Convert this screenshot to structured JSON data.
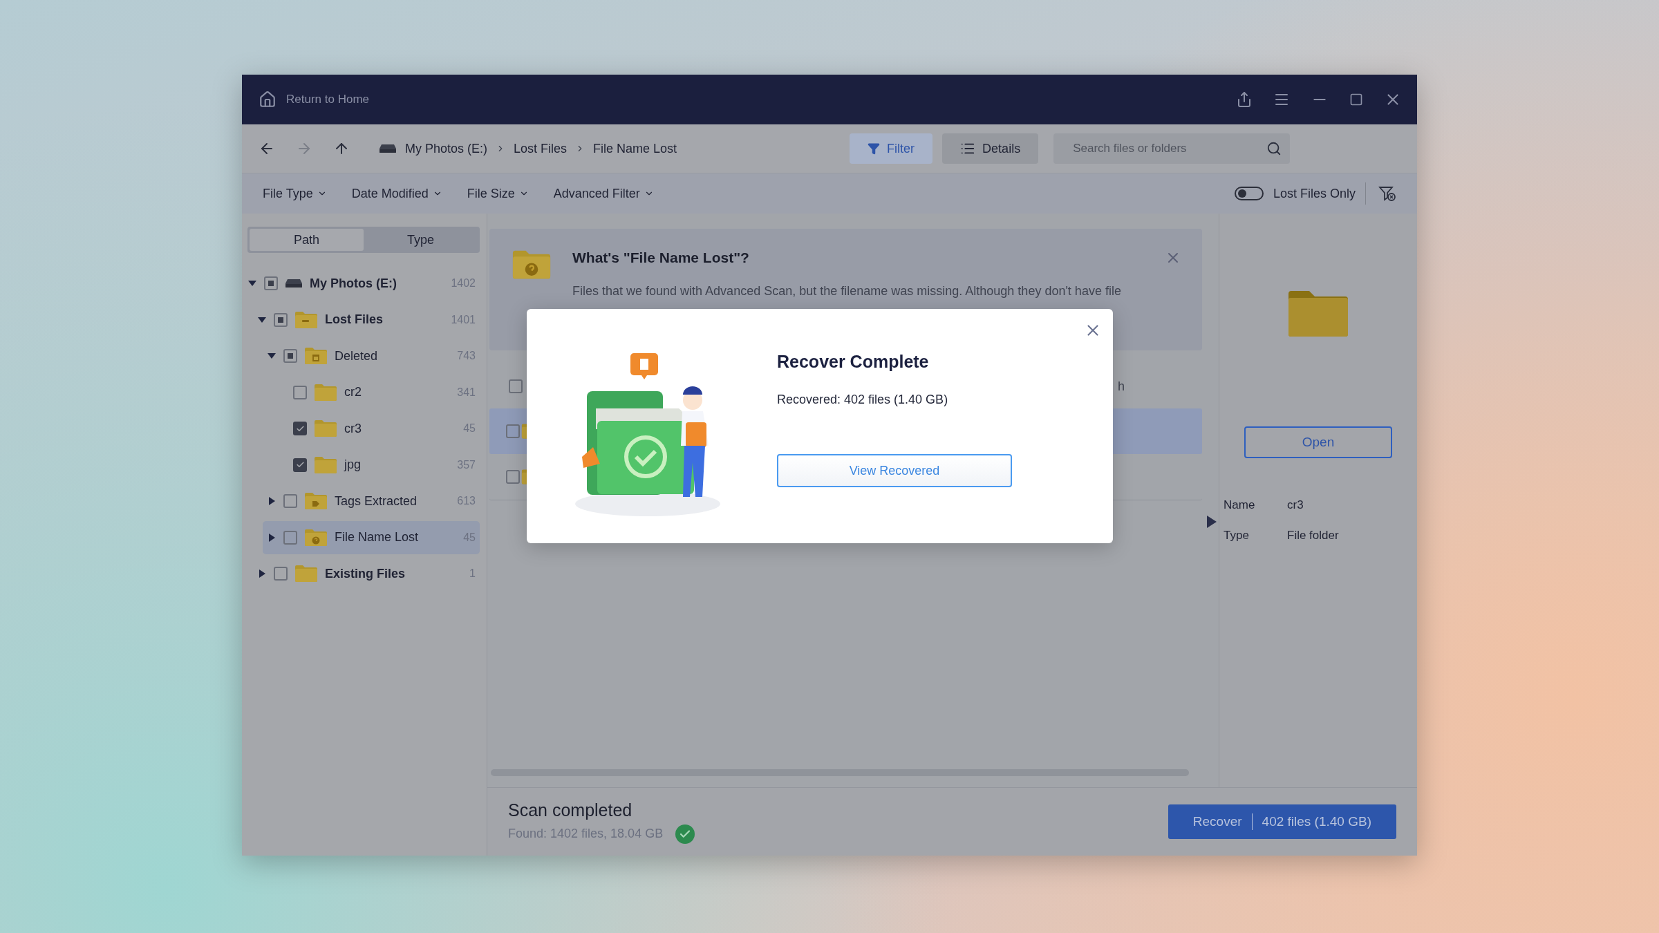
{
  "window": {
    "home_link": "Return to Home"
  },
  "toolbar": {
    "breadcrumb": [
      "My Photos (E:)",
      "Lost Files",
      "File Name Lost"
    ],
    "filter_button": {
      "label": "Filter",
      "selected": true
    },
    "details_button": {
      "label": "Details",
      "selected": false
    },
    "search": {
      "placeholder": "Search files or folders"
    }
  },
  "filters": {
    "dropdowns": [
      "File Type",
      "Date Modified",
      "File Size",
      "Advanced Filter"
    ],
    "lost_files_only": {
      "label": "Lost Files Only",
      "on": false
    }
  },
  "sidebar": {
    "tabs": [
      {
        "label": "Path",
        "selected": true
      },
      {
        "label": "Type",
        "selected": false
      }
    ],
    "tree": [
      {
        "label": "My Photos (E:)",
        "kind": "drive",
        "count": "1402",
        "partial": true,
        "expanded": true,
        "selected": false,
        "children": [
          {
            "label": "Lost Files",
            "kind": "lost",
            "count": "1401",
            "partial": true,
            "expanded": true,
            "selected": false,
            "children": [
              {
                "label": "Deleted",
                "kind": "deleted",
                "count": "743",
                "partial": true,
                "expanded": true,
                "selected": false,
                "children": [
                  {
                    "label": "cr2",
                    "kind": "folder",
                    "count": "341",
                    "checked": false,
                    "selected": false
                  },
                  {
                    "label": "cr3",
                    "kind": "folder",
                    "count": "45",
                    "checked": true,
                    "selected": false
                  },
                  {
                    "label": "jpg",
                    "kind": "folder",
                    "count": "357",
                    "checked": true,
                    "selected": false
                  }
                ]
              },
              {
                "label": "Tags Extracted",
                "kind": "tags",
                "count": "613",
                "checked": false,
                "expanded": false,
                "selected": false
              },
              {
                "label": "File Name Lost",
                "kind": "unknown",
                "count": "45",
                "checked": false,
                "expanded": false,
                "selected": true
              }
            ]
          },
          {
            "label": "Existing Files",
            "kind": "folder",
            "count": "1",
            "checked": false,
            "expanded": false,
            "selected": false
          }
        ]
      }
    ]
  },
  "info_card": {
    "title": "What's \"File Name Lost\"?",
    "text": "Files that we found with Advanced Scan, but the filename was missing. Although they don't have file"
  },
  "file_list": {
    "header": {
      "checked": false,
      "column_2": "h"
    },
    "rows": [
      {
        "checked": false,
        "selected": true
      },
      {
        "checked": false,
        "selected": false
      }
    ]
  },
  "details": {
    "open_button": "Open",
    "properties": [
      {
        "name": "Name",
        "value": "cr3"
      },
      {
        "name": "Type",
        "value": "File folder"
      }
    ]
  },
  "status": {
    "title": "Scan completed",
    "summary": "Found: 1402 files, 18.04 GB",
    "recover_button": {
      "label": "Recover",
      "info": "402 files (1.40 GB)"
    }
  },
  "dialog": {
    "title": "Recover Complete",
    "text": "Recovered: 402 files (1.40 GB)",
    "button": "View Recovered"
  }
}
